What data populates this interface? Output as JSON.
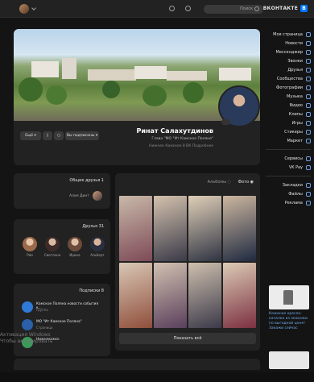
{
  "header": {
    "logo_text": "ВКОНТАКТЕ",
    "search_placeholder": "Поиск"
  },
  "nav": {
    "items": [
      {
        "label": "Моя страница",
        "icon": "home-icon"
      },
      {
        "label": "Новости",
        "icon": "news-icon"
      },
      {
        "label": "Мессенджер",
        "icon": "messenger-icon"
      },
      {
        "label": "Звонки",
        "icon": "phone-icon"
      },
      {
        "label": "Друзья",
        "icon": "friends-icon"
      },
      {
        "label": "Сообщества",
        "icon": "groups-icon"
      },
      {
        "label": "Фотографии",
        "icon": "photo-icon"
      },
      {
        "label": "Музыка",
        "icon": "music-icon"
      },
      {
        "label": "Видео",
        "icon": "video-icon"
      },
      {
        "label": "Клипы",
        "icon": "clips-icon"
      },
      {
        "label": "Игры",
        "icon": "games-icon"
      },
      {
        "label": "Стикеры",
        "icon": "stickers-icon"
      },
      {
        "label": "Маркет",
        "icon": "market-icon"
      }
    ],
    "items2": [
      {
        "label": "Сервисы",
        "icon": "services-icon"
      },
      {
        "label": "VK Pay",
        "icon": "vkpay-icon"
      }
    ],
    "items3": [
      {
        "label": "Закладки",
        "icon": "bookmark-icon"
      },
      {
        "label": "Файлы",
        "icon": "files-icon"
      },
      {
        "label": "Реклама",
        "icon": "ads-icon"
      }
    ]
  },
  "profile": {
    "name": "Ринат Салахутдинов",
    "status": "Глава \"МО \"Ит Камское Поляне\"",
    "info": "Нижнее Камское   8 ВК   Подробнее",
    "btn_subscribe": "Вы подписаны",
    "btn_more": "Ещё"
  },
  "friends_common": {
    "title": "Общие друзья 1",
    "name": "Алия Динт"
  },
  "friends": {
    "title": "Друзья 31",
    "list": [
      {
        "name": "Альберт"
      },
      {
        "name": "Ирина"
      },
      {
        "name": "Светлана"
      },
      {
        "name": "Рия"
      }
    ]
  },
  "subscriptions": {
    "title": "Подписки 8",
    "list": [
      {
        "title": "Камское Поляна новости события к...",
        "sub": "группа"
      },
      {
        "title": "МО \"Ит Камское Поляна\"",
        "sub": "Страница"
      },
      {
        "title": "Нижнекамск",
        "sub": ""
      }
    ]
  },
  "photos": {
    "tab_photos": "Фото",
    "tab_albums": "Альбомы",
    "show_all": "Показать всё"
  },
  "ad": {
    "text": "Кожаное кресло-качалка из экокожи по выгодной цене! Закажи сейчас"
  },
  "watermark": {
    "line1": "Активация Windows",
    "line2": "Чтобы активировать"
  }
}
